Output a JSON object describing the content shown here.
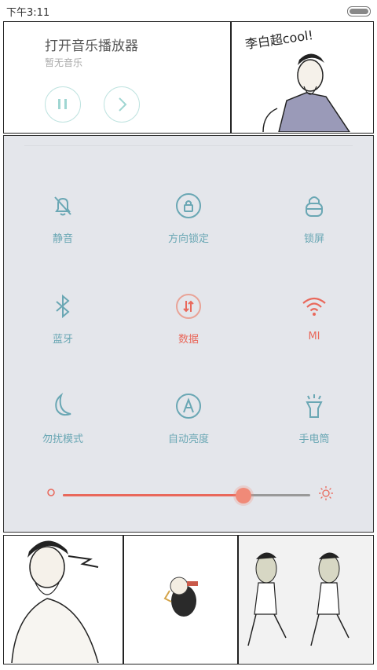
{
  "status_bar": {
    "time": "下午3:11"
  },
  "music_widget": {
    "title": "打开音乐播放器",
    "subtitle": "暂无音乐"
  },
  "meme_top": {
    "caption": "李白超cool!"
  },
  "controls": {
    "tiles": [
      {
        "label": "静音",
        "icon": "bell-muted-icon",
        "active": false
      },
      {
        "label": "方向锁定",
        "icon": "rotation-lock-icon",
        "active": false
      },
      {
        "label": "锁屏",
        "icon": "lock-icon",
        "active": false
      },
      {
        "label": "蓝牙",
        "icon": "bluetooth-icon",
        "active": false
      },
      {
        "label": "数据",
        "icon": "mobile-data-icon",
        "active": true
      },
      {
        "label": "MI",
        "icon": "wifi-icon",
        "active": true
      },
      {
        "label": "勿扰模式",
        "icon": "moon-icon",
        "active": false
      },
      {
        "label": "自动亮度",
        "icon": "auto-brightness-icon",
        "active": false
      },
      {
        "label": "手电筒",
        "icon": "flashlight-icon",
        "active": false
      }
    ],
    "brightness": 0.73
  },
  "colors": {
    "accent": "#6aa7b4",
    "active": "#e9685b",
    "panel_bg": "#e4e6eb"
  }
}
